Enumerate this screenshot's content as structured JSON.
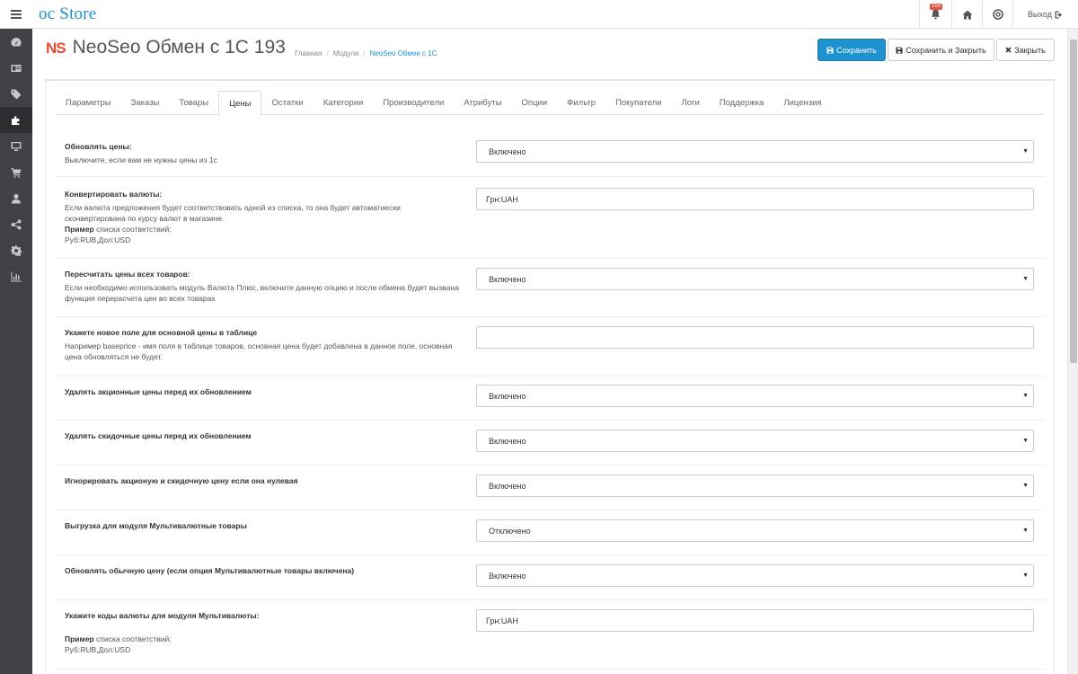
{
  "header": {
    "logo_oc": "oc",
    "logo_store": "Store",
    "notification_count": "155",
    "logout_label": "Выход"
  },
  "sidebar": {
    "items": [
      "dashboard-icon",
      "catalog-icon",
      "tags-icon",
      "extensions-icon",
      "design-icon",
      "sales-icon",
      "customers-icon",
      "marketing-icon",
      "settings-icon",
      "reports-icon"
    ]
  },
  "page": {
    "logo_text": "NS",
    "title": "NeoSeo Обмен с 1С 193",
    "breadcrumb": [
      "Главная",
      "Модули",
      "NeoSeo Обмен с 1С"
    ]
  },
  "buttons": {
    "save": "Сохранить",
    "save_close": "Сохранить и Закрыть",
    "close": "Закрыть"
  },
  "tabs": [
    "Параметры",
    "Заказы",
    "Товары",
    "Цены",
    "Остатки",
    "Категории",
    "Производители",
    "Атрибуты",
    "Опции",
    "Фильтр",
    "Покупатели",
    "Логи",
    "Поддержка",
    "Лицензия"
  ],
  "active_tab": "Цены",
  "form": {
    "update_prices": {
      "title": "Обновлять цены:",
      "desc": "Выключите, если вам не нужны цены из 1с",
      "value": "Включено"
    },
    "convert_currency": {
      "title": "Конвертировать валюты:",
      "desc": "Если валюта предложения будет соответствовать одной из списка, то она будет автоматиески сконвертирована по курсу валют в магазине.",
      "example_label": "Пример",
      "example_text": "списка соответствий:",
      "example_value": "Руб:RUB,Дол:USD",
      "value": "Грн:UAH"
    },
    "recalc_prices": {
      "title": "Пересчитать цены всех товаров:",
      "desc": "Если необходимо использовать модуль Валюта Плюс, включите данную опцию и после обмена будет вызвана функция перерасчета цен во всех товарах",
      "value": "Включено"
    },
    "base_price_field": {
      "title": "Укажете новое поле для основной цены в таблице",
      "desc": "Например baseprice - имя поля в таблице товаров, основная цена будет добавлена в данное поле, основная цена обновляться не будет.",
      "value": ""
    },
    "delete_special": {
      "title": "Удалять акционные цены перед их обновлением",
      "value": "Включено"
    },
    "delete_discount": {
      "title": "Удалять скидочные цены перед их обновлением",
      "value": "Включено"
    },
    "ignore_zero": {
      "title": "Игнорировать акционую и скидочную цену если она нулевая",
      "value": "Включено"
    },
    "multicurrency_export": {
      "title": "Выгрузка для модуля Мультивалютные товары",
      "value": "Отключено"
    },
    "update_regular": {
      "title": "Обновлять обычную цену (если опция Мультивалютные товары включена)",
      "value": "Включено"
    },
    "currency_codes": {
      "title": "Укажите коды валюты для модуля Мультивалюты:",
      "example_label": "Пример",
      "example_text": "списка соответствий:",
      "example_value": "Руб:RUB,Дол:USD",
      "value": "Грн:UAH"
    }
  }
}
